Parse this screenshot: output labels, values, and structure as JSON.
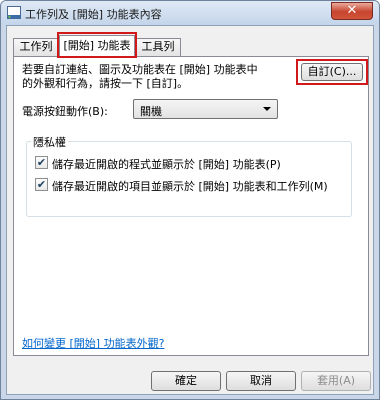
{
  "window": {
    "title": "工作列及 [開始] 功能表內容",
    "close_glyph": "✕"
  },
  "tabs": [
    {
      "label": "工作列",
      "active": false
    },
    {
      "label": "[開始] 功能表",
      "active": true
    },
    {
      "label": "工具列",
      "active": false
    }
  ],
  "description": {
    "line1": "若要自訂連結、圖示及功能表在 [開始] 功能表中",
    "line2": "的外觀和行為，請按一下 [自訂]。"
  },
  "customize_button": "自訂(C)...",
  "power_button": {
    "label": "電源按鈕動作(B):",
    "value": "關機"
  },
  "privacy": {
    "title": "隱私權",
    "items": [
      {
        "label": "儲存最近開啟的程式並顯示於 [開始] 功能表(P)",
        "checked": true
      },
      {
        "label": "儲存最近開啟的項目並顯示於 [開始] 功能表和工作列(M)",
        "checked": true
      }
    ]
  },
  "help_link": "如何變更 [開始] 功能表外觀?",
  "footer": {
    "ok": "確定",
    "cancel": "取消",
    "apply": "套用(A)"
  },
  "colors": {
    "highlight": "#d2191a",
    "link": "#0066cc"
  }
}
